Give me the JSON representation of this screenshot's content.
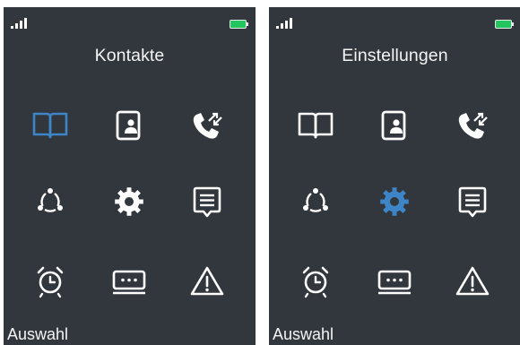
{
  "colors": {
    "screen_bg": "#32363d",
    "icon_default": "#ffffff",
    "icon_selected": "#3d85c6",
    "battery": "#22c55e"
  },
  "screens": [
    {
      "title": "Kontakte",
      "softkey_left": "Auswahl",
      "selected_icon": "phonebook-icon",
      "menu": [
        "phonebook-icon",
        "contact-card-icon",
        "call-log-icon",
        "connection-icon",
        "settings-gear-icon",
        "messages-icon",
        "alarm-clock-icon",
        "keyboard-icon",
        "warning-icon"
      ]
    },
    {
      "title": "Einstellungen",
      "softkey_left": "Auswahl",
      "selected_icon": "settings-gear-icon",
      "menu": [
        "phonebook-icon",
        "contact-card-icon",
        "call-log-icon",
        "connection-icon",
        "settings-gear-icon",
        "messages-icon",
        "alarm-clock-icon",
        "keyboard-icon",
        "warning-icon"
      ]
    }
  ]
}
